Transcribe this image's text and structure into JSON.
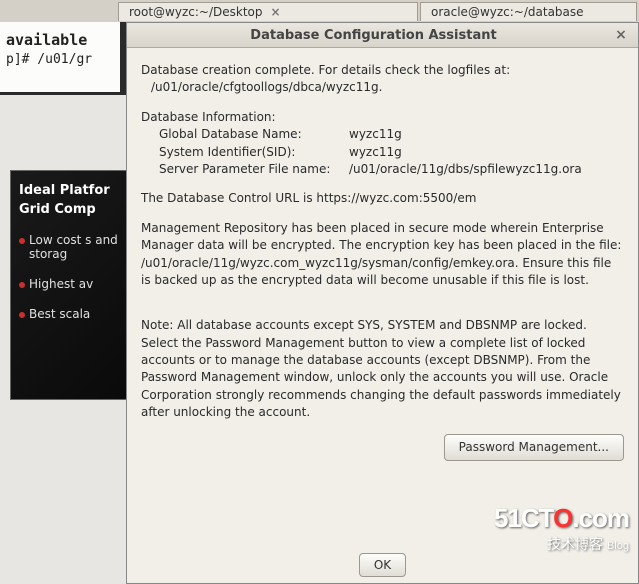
{
  "tabs": {
    "first": "root@wyzc:~/Desktop",
    "second": "oracle@wyzc:~/database"
  },
  "terminal": {
    "line1": "available",
    "line2": "p]# /u01/gr"
  },
  "leftPanel": {
    "title1": "Ideal Platfor",
    "title2": "Grid Comp",
    "bullets": [
      "Low cost s\nand storag",
      "Highest av",
      "Best scala"
    ]
  },
  "dialog": {
    "title": "Database Configuration Assistant",
    "p1": "Database creation complete. For details check the logfiles at:",
    "p1path": "/u01/oracle/cfgtoollogs/dbca/wyzc11g.",
    "infoHeader": "Database Information:",
    "rows": [
      {
        "label": "Global Database Name:",
        "value": "wyzc11g"
      },
      {
        "label": "System Identifier(SID):",
        "value": "wyzc11g"
      },
      {
        "label": "Server Parameter File name:",
        "value": "/u01/oracle/11g/dbs/spfilewyzc11g.ora"
      }
    ],
    "controlUrl": "The Database Control URL is https://wyzc.com:5500/em",
    "repo": "Management Repository has been placed in secure mode wherein Enterprise Manager data will be encrypted.  The encryption key has been placed in the file: /u01/oracle/11g/wyzc.com_wyzc11g/sysman/config/emkey.ora.  Ensure this file is backed up as the encrypted data will become unusable if this file is lost.",
    "note": "Note: All database accounts except SYS, SYSTEM and DBSNMP are locked. Select the Password Management button to view a complete list of locked accounts or to manage the database accounts (except DBSNMP). From the Password Management window, unlock only the accounts you will use. Oracle Corporation strongly recommends changing the default passwords immediately after unlocking the account.",
    "pwBtn": "Password Management...",
    "okBtn": "OK"
  },
  "watermark": {
    "brand_pre": "51CT",
    "brand_o": "O",
    "brand_post": ".com",
    "sub": "技术博客",
    "blog": "Blog"
  }
}
